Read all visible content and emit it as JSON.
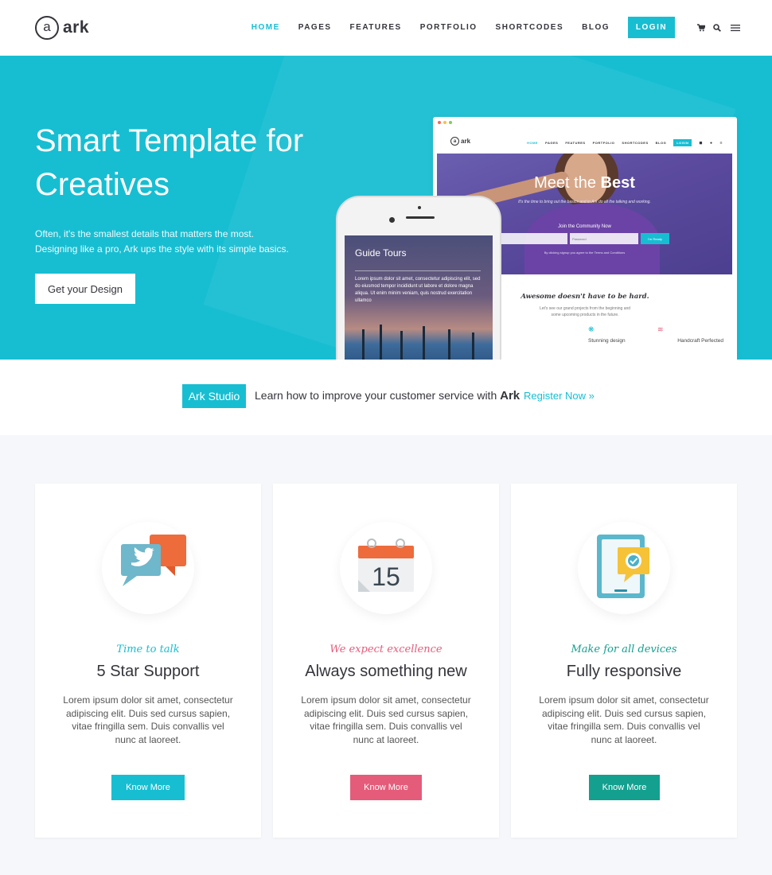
{
  "header": {
    "logo_letter": "a",
    "logo_text": "ark",
    "nav": [
      "HOME",
      "PAGES",
      "FEATURES",
      "PORTFOLIO",
      "SHORTCODES",
      "BLOG"
    ],
    "login_label": "LOGIN",
    "icons": [
      "cart-icon",
      "search-icon",
      "menu-icon"
    ]
  },
  "hero": {
    "title": "Smart Template for Creatives",
    "subtitle_line1": "Often, it's the smallest details that matters the most.",
    "subtitle_line2": "Designing like a pro, Ark ups the style with its simple basics.",
    "cta_label": "Get your Design"
  },
  "browser_mockup": {
    "logo_text": "ark",
    "nav": [
      "HOME",
      "PAGES",
      "FEATURES",
      "PORTFOLIO",
      "SHORTCODES",
      "BLOG"
    ],
    "login": "LOGIN",
    "hero_title_plain": "Meet the ",
    "hero_title_bold": "Best",
    "hero_text": "It's the time to bring out the basics and in Ark do all the talking and working.",
    "join_text": "Join the Community Now",
    "password_placeholder": "Password",
    "button": "I'm Ready",
    "agree_text": "By clicking signup you agree to the Terms and Conditions",
    "section_title": "Awesome doesn't have to be hard.",
    "section_sub_line1": "Let's see our grand projects from the beginning and",
    "section_sub_line2": "some upcoming products in the future.",
    "features": [
      "Stunning design",
      "Handcraft Perfected"
    ]
  },
  "phone_mockup": {
    "title": "Guide Tours",
    "text": "Lorem ipsum dolor sit amet, consectetur adipiscing elit, sed do eiusmod tempor incididunt ut labore et dolore magna aliqua. Ut enim minim veniam, quis nostrud exercitation ullamco"
  },
  "promo": {
    "badge": "Ark Studio",
    "text": "Learn how to improve your customer service with ",
    "brand": "Ark",
    "link": "Register Now »"
  },
  "colors": {
    "primary": "#17bed2",
    "pink": "#e55c7a",
    "teal": "#13a08f",
    "dark_text": "#34343c"
  },
  "cards": [
    {
      "icon": "twitter-chat-icon",
      "subtitle": "Time to talk",
      "subtitle_color": "#17bed2",
      "title": "5 Star Support",
      "body": "Lorem ipsum dolor sit amet, consectetur adipiscing elit. Duis sed cursus sapien, vitae fringilla sem. Duis convallis vel nunc at laoreet.",
      "button": "Know More",
      "button_color": "#17bed2"
    },
    {
      "icon": "calendar-icon",
      "calendar_day": "15",
      "subtitle": "We expect excellence",
      "subtitle_color": "#e55c7a",
      "title": "Always something new",
      "body": "Lorem ipsum dolor sit amet, consectetur adipiscing elit. Duis sed cursus sapien, vitae fringilla sem. Duis convallis vel nunc at laoreet.",
      "button": "Know More",
      "button_color": "#e55c7a"
    },
    {
      "icon": "tablet-check-icon",
      "subtitle": "Make for all devices",
      "subtitle_color": "#13a08f",
      "title": "Fully responsive",
      "body": "Lorem ipsum dolor sit amet, consectetur adipiscing elit. Duis sed cursus sapien, vitae fringilla sem. Duis convallis vel nunc at laoreet.",
      "button": "Know More",
      "button_color": "#13a08f"
    }
  ]
}
